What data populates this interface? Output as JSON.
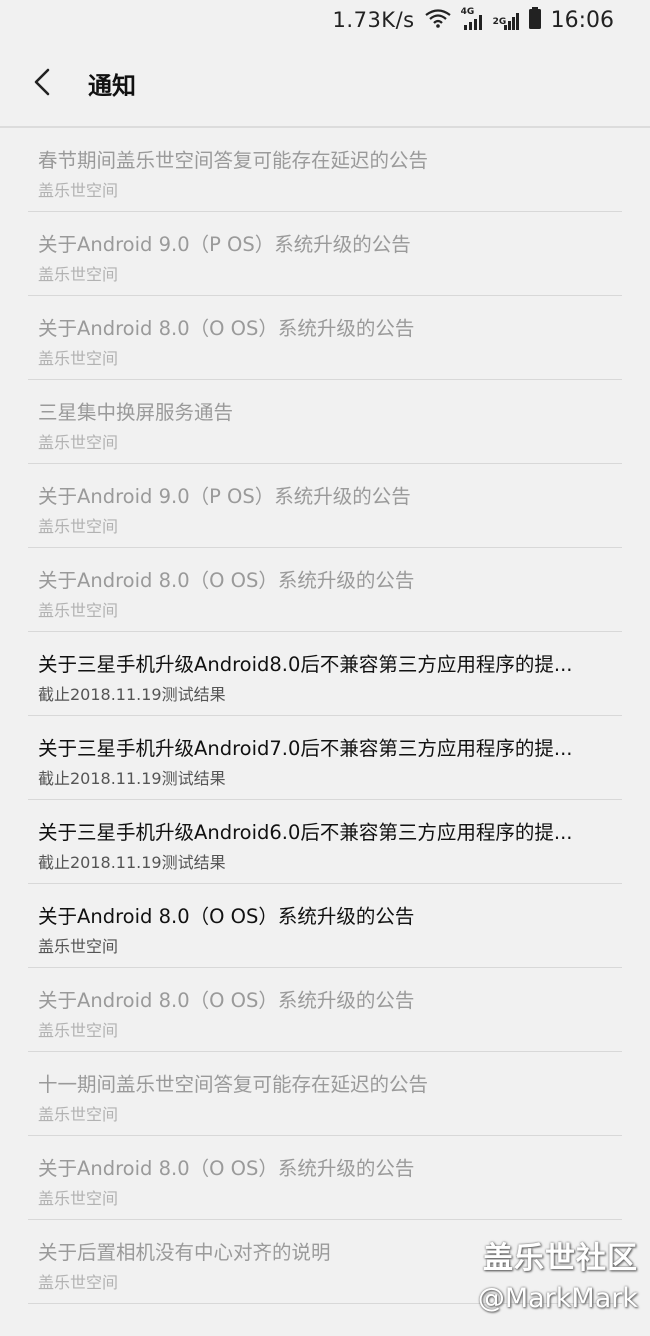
{
  "status_bar": {
    "speed": "1.73K/s",
    "time": "16:06",
    "network_4g": "4G",
    "network_2g": "2G",
    "icons": [
      "wifi-icon",
      "signal-4g-icon",
      "signal-2g-icon",
      "battery-icon"
    ]
  },
  "header": {
    "title": "通知",
    "back_icon": "chevron-left-icon"
  },
  "notifications": [
    {
      "title": "春节期间盖乐世空间答复可能存在延迟的公告",
      "subtitle": "盖乐世空间",
      "read": true
    },
    {
      "title": "关于Android 9.0（P OS）系统升级的公告",
      "subtitle": "盖乐世空间",
      "read": true
    },
    {
      "title": "关于Android 8.0（O OS）系统升级的公告",
      "subtitle": "盖乐世空间",
      "read": true
    },
    {
      "title": "三星集中换屏服务通告",
      "subtitle": "盖乐世空间",
      "read": true
    },
    {
      "title": "关于Android 9.0（P OS）系统升级的公告",
      "subtitle": "盖乐世空间",
      "read": true
    },
    {
      "title": "关于Android 8.0（O OS）系统升级的公告",
      "subtitle": "盖乐世空间",
      "read": true
    },
    {
      "title": "关于三星手机升级Android8.0后不兼容第三方应用程序的提...",
      "subtitle": "截止2018.11.19测试结果",
      "read": false
    },
    {
      "title": "关于三星手机升级Android7.0后不兼容第三方应用程序的提...",
      "subtitle": "截止2018.11.19测试结果",
      "read": false
    },
    {
      "title": "关于三星手机升级Android6.0后不兼容第三方应用程序的提...",
      "subtitle": "截止2018.11.19测试结果",
      "read": false
    },
    {
      "title": "关于Android 8.0（O OS）系统升级的公告",
      "subtitle": "盖乐世空间",
      "read": false
    },
    {
      "title": "关于Android 8.0（O OS）系统升级的公告",
      "subtitle": "盖乐世空间",
      "read": true
    },
    {
      "title": "十一期间盖乐世空间答复可能存在延迟的公告",
      "subtitle": "盖乐世空间",
      "read": true
    },
    {
      "title": "关于Android 8.0（O OS）系统升级的公告",
      "subtitle": "盖乐世空间",
      "read": true
    },
    {
      "title": "关于后置相机没有中心对齐的说明",
      "subtitle": "盖乐世空间",
      "read": true
    }
  ],
  "watermark": {
    "line1": "盖乐世社区",
    "line2": "@MarkMark"
  },
  "colors": {
    "background": "#f1f1f1",
    "read_title": "#9a9a9a",
    "unread_title": "#111111",
    "divider": "#d8d8d8"
  }
}
